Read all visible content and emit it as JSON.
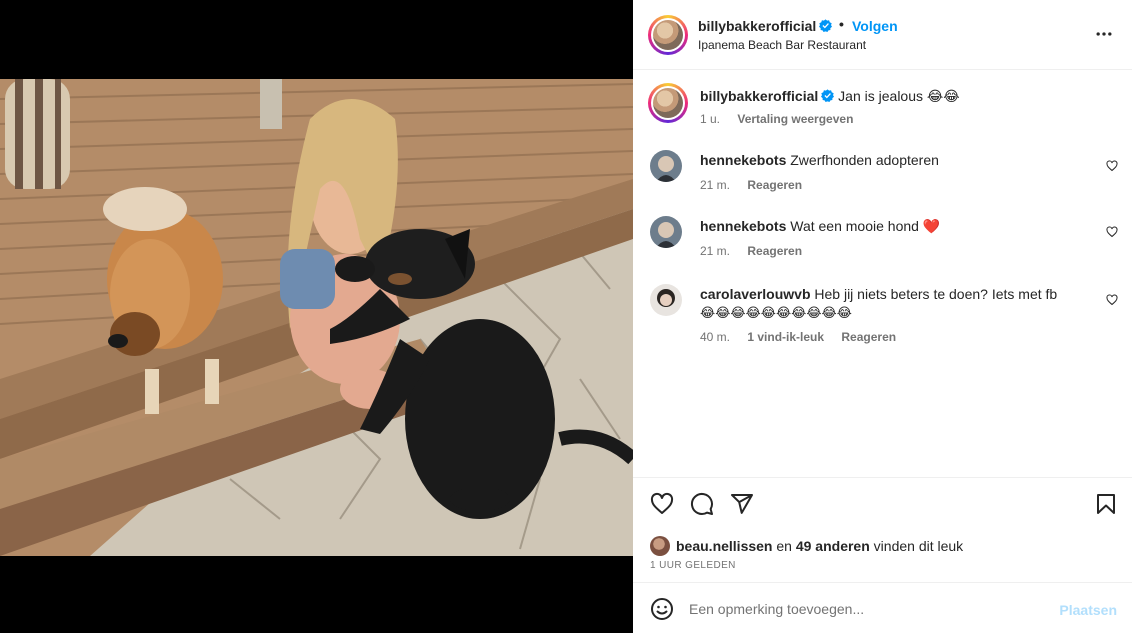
{
  "header": {
    "username": "billybakkerofficial",
    "dot": "•",
    "follow_label": "Volgen",
    "location": "Ipanema Beach Bar Restaurant"
  },
  "caption": {
    "username": "billybakkerofficial",
    "text": "Jan is jealous 😂😂",
    "time": "1 u.",
    "translate": "Vertaling weergeven"
  },
  "comments": [
    {
      "username": "hennekebots",
      "text": "Zwerfhonden adopteren",
      "time": "21 m.",
      "reply": "Reageren"
    },
    {
      "username": "hennekebots",
      "text": "Wat een mooie hond ❤️",
      "time": "21 m.",
      "reply": "Reageren"
    },
    {
      "username": "carolaverlouwvb",
      "text": "Heb jij niets beters te doen? Iets met fb",
      "text2": "😂😂😂😂😂😂😂😂😂😂",
      "time": "40 m.",
      "likes": "1 vind-ik-leuk",
      "reply": "Reageren"
    }
  ],
  "likes": {
    "user": "beau.nellissen",
    "connector": "en",
    "others": "49 anderen",
    "suffix": "vinden dit leuk"
  },
  "timeago": "1 UUR GELEDEN",
  "add_comment": {
    "placeholder": "Een opmerking toevoegen...",
    "post_label": "Plaatsen"
  },
  "colors": {
    "accent": "#0095f6",
    "post_disabled": "#b2dffc",
    "heart_red": "#ed4956"
  },
  "icons": [
    "verified-badge-icon",
    "more-options-icon",
    "heart-icon",
    "comment-icon",
    "share-icon",
    "bookmark-icon",
    "emoji-icon"
  ]
}
